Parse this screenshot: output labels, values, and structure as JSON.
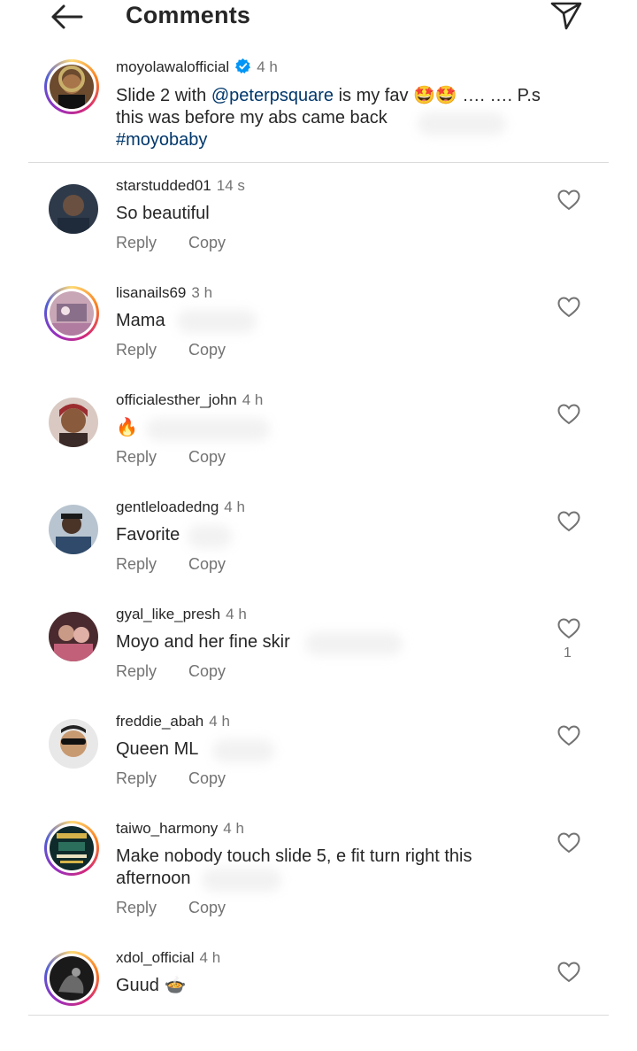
{
  "header": {
    "title": "Comments",
    "back_icon": "arrow-left-icon",
    "send_icon": "send-icon"
  },
  "caption": {
    "username": "moyolawalofficial",
    "time": "4 h",
    "text_before": "Slide 2 with ",
    "mention": "@peterpsquare",
    "text_after": " is my fav 🤩🤩 …. …. P.s",
    "line2": "this was before my abs came back",
    "hashtag": "#moyobaby"
  },
  "actions": {
    "reply": "Reply",
    "copy": "Copy"
  },
  "colors": {
    "link": "#00376b",
    "secondary": "#737373",
    "verified": "#0095f6",
    "divider": "#dbdbdb"
  },
  "comments": [
    {
      "username": "starstudded01",
      "time": "14 s",
      "text": "So beautiful",
      "likes": ""
    },
    {
      "username": "lisanails69",
      "time": "3 h",
      "text": "Mama",
      "likes": ""
    },
    {
      "username": "officialesther_john",
      "time": "4 h",
      "text": "🔥",
      "likes": ""
    },
    {
      "username": "gentleloadedng",
      "time": "4 h",
      "text": "Favorite",
      "likes": ""
    },
    {
      "username": "gyal_like_presh",
      "time": "4 h",
      "text": "Moyo and her fine skir",
      "likes": "1"
    },
    {
      "username": "freddie_abah",
      "time": "4 h",
      "text": "Queen ML",
      "likes": ""
    },
    {
      "username": "taiwo_harmony",
      "time": "4 h",
      "text": "Make nobody touch slide 5, e fit turn right this",
      "text2": "afternoon",
      "likes": ""
    },
    {
      "username": "xdol_official",
      "time": "4 h",
      "text": "Guud 🍲",
      "likes": ""
    }
  ]
}
